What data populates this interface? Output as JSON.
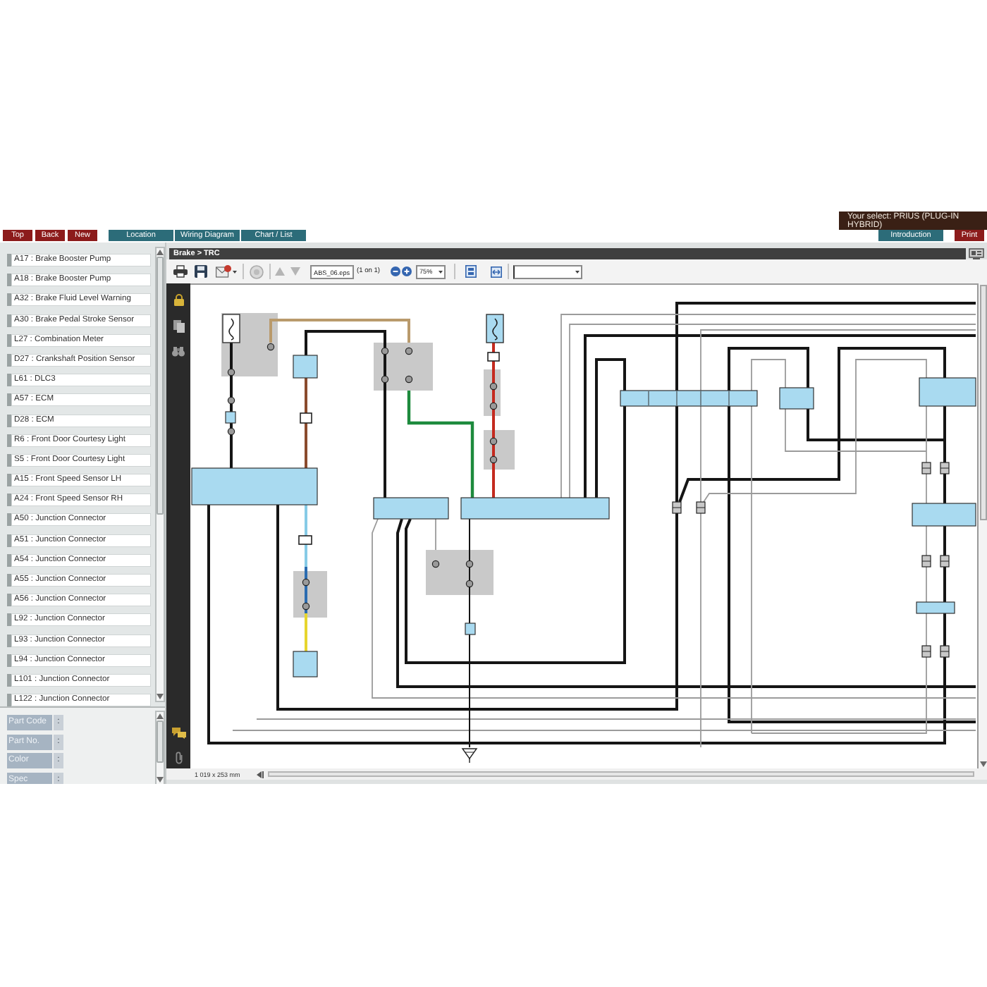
{
  "header": {
    "vehicle_select": "Your select: PRIUS (PLUG-IN HYBRID)",
    "left_buttons": [
      {
        "label": "Top",
        "kind": "action"
      },
      {
        "label": "Back",
        "kind": "action"
      },
      {
        "label": "New",
        "kind": "action"
      },
      {
        "label": "Location",
        "kind": "view"
      },
      {
        "label": "Wiring Diagram",
        "kind": "view"
      },
      {
        "label": "Chart / List",
        "kind": "view"
      }
    ],
    "right_buttons": [
      {
        "label": "Introduction",
        "kind": "view"
      },
      {
        "label": "Print",
        "kind": "action"
      }
    ]
  },
  "sidebar": {
    "items": [
      {
        "label": "A17 : Brake Booster Pump"
      },
      {
        "label": "A18 : Brake Booster Pump"
      },
      {
        "label": "A32 : Brake Fluid Level Warning"
      },
      {
        "label": "A30 : Brake Pedal Stroke Sensor"
      },
      {
        "label": "L27 : Combination Meter"
      },
      {
        "label": "D27 : Crankshaft Position Sensor"
      },
      {
        "label": "L61 : DLC3"
      },
      {
        "label": "A57 : ECM"
      },
      {
        "label": "D28 : ECM"
      },
      {
        "label": "R6 : Front Door Courtesy Light"
      },
      {
        "label": "S5 : Front Door Courtesy Light"
      },
      {
        "label": "A15 : Front Speed Sensor LH"
      },
      {
        "label": "A24 : Front Speed Sensor RH"
      },
      {
        "label": "A50 : Junction Connector"
      },
      {
        "label": "A51 : Junction Connector"
      },
      {
        "label": "A54 : Junction Connector"
      },
      {
        "label": "A55 : Junction Connector"
      },
      {
        "label": "A56 : Junction Connector"
      },
      {
        "label": "L92 : Junction Connector"
      },
      {
        "label": "L93 : Junction Connector"
      },
      {
        "label": "L94 : Junction Connector"
      },
      {
        "label": "L101 : Junction Connector"
      },
      {
        "label": "L122 : Junction Connector"
      }
    ]
  },
  "part_info": {
    "fields": [
      {
        "label": "Part Code",
        "separator": ":"
      },
      {
        "label": "Part No.",
        "separator": ":"
      },
      {
        "label": "Color",
        "separator": ":"
      },
      {
        "label": "Spec",
        "separator": ":"
      }
    ]
  },
  "viewer": {
    "breadcrumb": "Brake > TRC",
    "toolbar": {
      "file_name": "ABS_06.eps",
      "page_count": "(1 on 1)",
      "zoom": "75%"
    },
    "status_bar": {
      "dimensions": "1 019 x 253 mm"
    }
  }
}
